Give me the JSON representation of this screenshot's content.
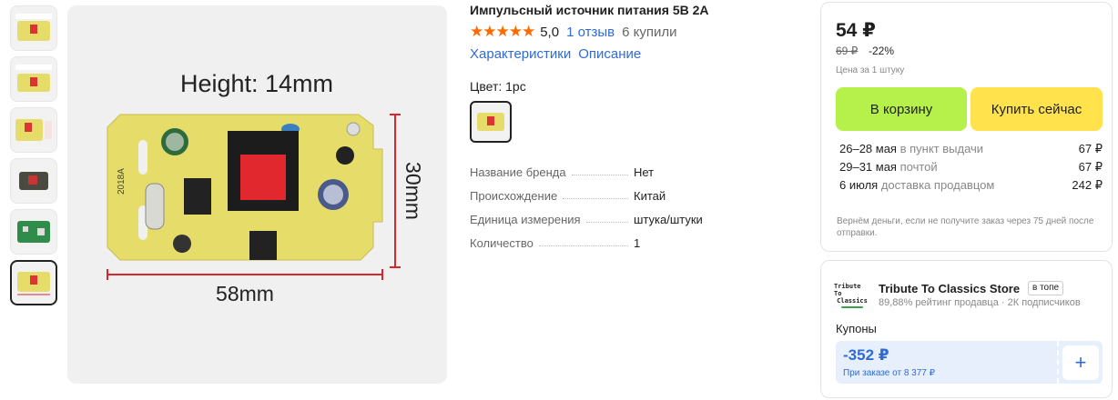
{
  "product": {
    "title": "Импульсный источник питания 5В 2А",
    "rating_stars": "★★★★★",
    "rating_value": "5,0",
    "reviews_link": "1 отзыв",
    "bought": "6 купили",
    "tabs": [
      "Характеристики",
      "Описание"
    ],
    "color_label": "Цвет: 1pc",
    "image_labels": {
      "height": "Height: 14mm",
      "width_dim": "58mm",
      "depth_dim": "30mm",
      "board_mark": "2018A"
    },
    "specs": [
      {
        "name": "Название бренда",
        "value": "Нет"
      },
      {
        "name": "Происхождение",
        "value": "Китай"
      },
      {
        "name": "Единица измерения",
        "value": "штука/штуки"
      },
      {
        "name": "Количество",
        "value": "1"
      }
    ]
  },
  "purchase": {
    "price": "54 ₽",
    "old_price": "69 ₽",
    "discount": "-22%",
    "unit_note": "Цена за 1 штуку",
    "cart_button": "В корзину",
    "buy_button": "Купить сейчас",
    "delivery": [
      {
        "date": "26–28 мая",
        "method": "в пункт выдачи",
        "price": "67 ₽"
      },
      {
        "date": "29–31 мая",
        "method": "почтой",
        "price": "67 ₽"
      },
      {
        "date": "6 июля",
        "method": "доставка продавцом",
        "price": "242 ₽"
      }
    ],
    "refund_note": "Вернём деньги, если не получите заказ через 75 дней после отправки."
  },
  "seller": {
    "logo_text_1": "Tribute To",
    "logo_text_2": "Classics",
    "name": "Tribute To Classics Store",
    "badge": "в топе",
    "rating": "89,88% рейтинг продавца",
    "subscribers": "2К подписчиков",
    "coupons_label": "Купоны",
    "coupon_amount": "-352 ₽",
    "coupon_condition": "При заказе от 8 377 ₽",
    "coupon_add_symbol": "+"
  },
  "colors": {
    "accent_link": "#2f6bd3",
    "cart_button": "#b6f04a",
    "buy_button": "#ffe24c",
    "stars": "#ff6a00",
    "dimension_lines": "#d9262e",
    "pcb": "#e6dc6a"
  },
  "icons": [
    "plus-icon",
    "star-icon"
  ]
}
